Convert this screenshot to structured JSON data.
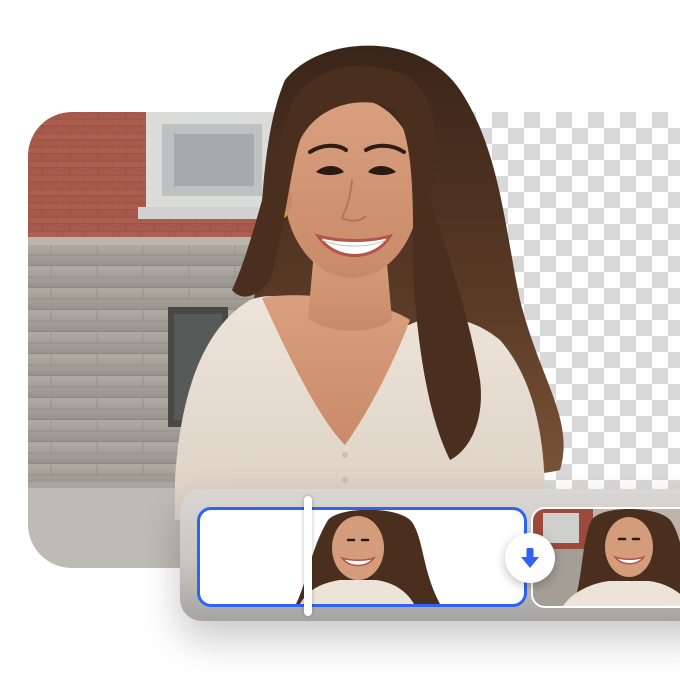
{
  "editor": {
    "accent_color": "#2e63f5",
    "transparency_pattern": "checkerboard",
    "icons": {
      "download": "arrow-down-icon"
    }
  }
}
